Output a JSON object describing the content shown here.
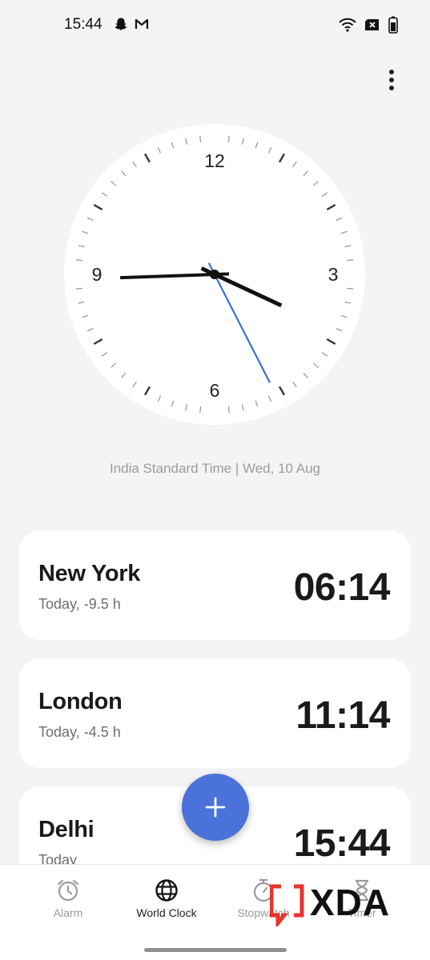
{
  "status_bar": {
    "time": "15:44"
  },
  "clock": {
    "numerals": {
      "n12": "12",
      "n3": "3",
      "n6": "6",
      "n9": "9"
    },
    "hour_hand_angle_deg": 115,
    "minute_hand_angle_deg": 268,
    "second_hand_angle_deg": 153,
    "hand_color": "#111111",
    "second_hand_color": "#3b6fd1"
  },
  "timezone_caption": "India Standard Time | Wed, 10 Aug",
  "cities": [
    {
      "name": "New York",
      "offset": "Today, -9.5 h",
      "time": "06:14"
    },
    {
      "name": "London",
      "offset": "Today, -4.5 h",
      "time": "11:14"
    },
    {
      "name": "Delhi",
      "offset": "Today",
      "time": "15:44"
    }
  ],
  "fab": {
    "icon": "plus-icon",
    "color": "#4a72d9"
  },
  "bottom_nav": {
    "alarm": "Alarm",
    "world_clock": "World Clock",
    "stopwatch": "Stopwatch",
    "timer": "Timer"
  },
  "watermark": {
    "text": "XDA",
    "accent": "#e8332f"
  }
}
